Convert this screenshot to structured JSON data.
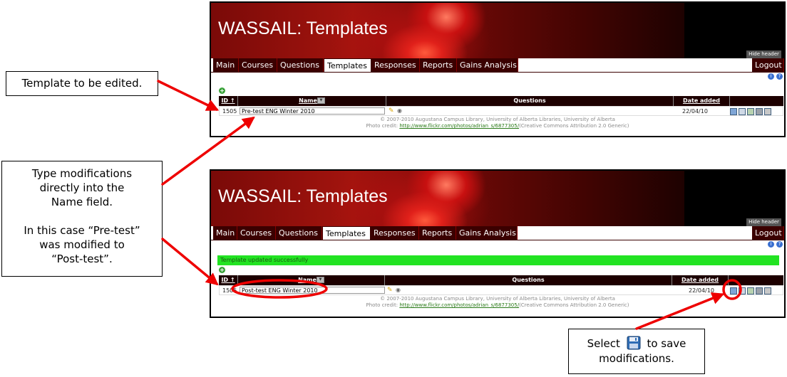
{
  "callouts": {
    "template": "Template to be edited.",
    "type": {
      "lines": [
        "Type modifications",
        "directly into the",
        "Name field."
      ],
      "lines2": [
        "In this case “Pre-test”",
        "was modified to",
        "“Post-test”."
      ]
    },
    "select": {
      "before": "Select",
      "after": "to save",
      "line2": "modifications.",
      "icon": "floppy-disk-icon"
    }
  },
  "app": {
    "title": "WASSAIL: Templates",
    "hide_header": "Hide header",
    "tabs": [
      "Main",
      "Courses",
      "Questions",
      "Templates",
      "Responses",
      "Reports",
      "Gains Analysis"
    ],
    "active_tab": "Templates",
    "logout": "Logout",
    "columns": {
      "id": "ID",
      "name": "Name",
      "questions": "Questions",
      "date_added": "Date added"
    },
    "footer_line1": "© 2007-2010 Augustana Campus Library, University of Alberta Libraries, University of Alberta",
    "footer_credit_label": "Photo credit:",
    "footer_credit_link": "http://www.flickr.com/photos/adrian_s/6877305/",
    "footer_credit_rest": "(Creative Commons Attribution 2.0 Generic)"
  },
  "screen1": {
    "row": {
      "id": "1505",
      "name": "Pre-test ENG Winter 2010",
      "date": "22/04/10"
    }
  },
  "screen2": {
    "success": "Template updated successfully",
    "row": {
      "id": "1505",
      "name": "Post-test ENG Winter 2010",
      "date": "22/04/10"
    }
  },
  "colors": {
    "nav_bg": "#3b0000",
    "header_bg": "#1d0000",
    "success_bg": "#22e322",
    "annotation_red": "#ee0000"
  },
  "icons": [
    "info-icon",
    "help-icon",
    "add-icon",
    "pencil-icon",
    "eye-icon",
    "save-icon",
    "copy-icon",
    "spreadsheet-icon",
    "print-icon",
    "trash-icon",
    "sort-ascending-icon",
    "filter-icon"
  ]
}
